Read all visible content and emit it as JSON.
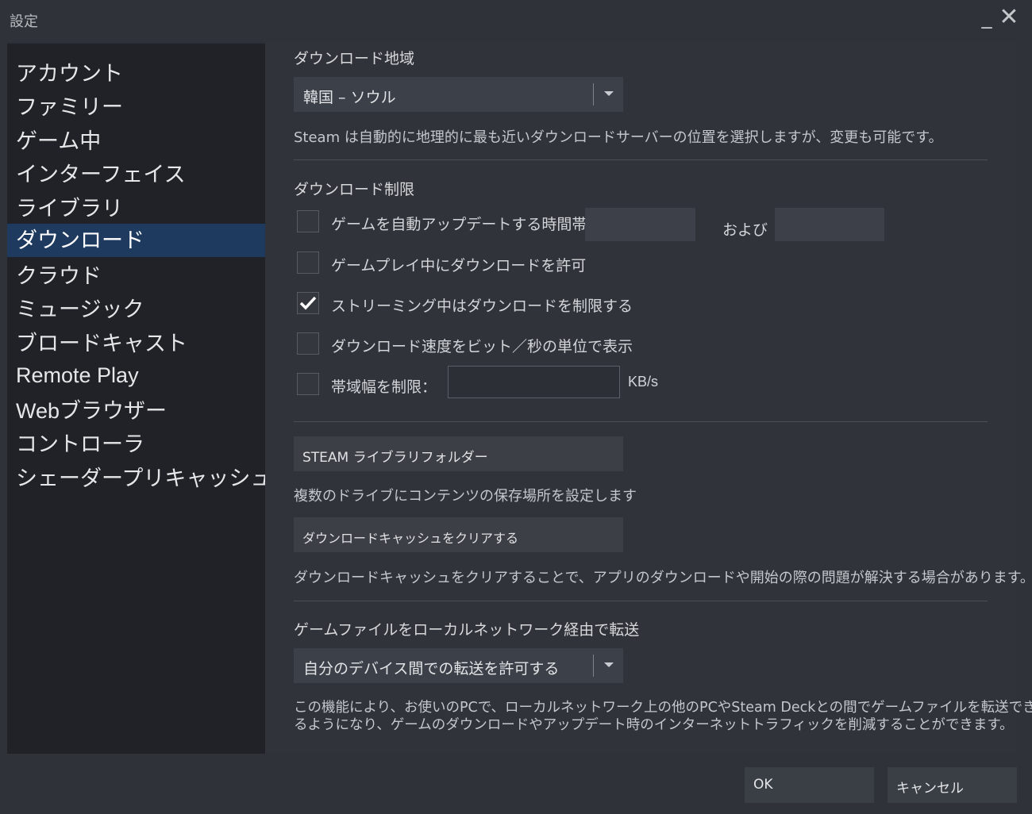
{
  "window": {
    "title": "設定",
    "minimize_label": "_",
    "close_label": "✕"
  },
  "sidebar": {
    "items": [
      {
        "label": "アカウント"
      },
      {
        "label": "ファミリー"
      },
      {
        "label": "ゲーム中"
      },
      {
        "label": "インターフェイス"
      },
      {
        "label": "ライブラリ"
      },
      {
        "label": "ダウンロード",
        "active": true
      },
      {
        "label": "クラウド"
      },
      {
        "label": "ミュージック"
      },
      {
        "label": "ブロードキャスト"
      },
      {
        "label": "Remote Play"
      },
      {
        "label": "Webブラウザー"
      },
      {
        "label": "コントローラ"
      },
      {
        "label": "シェーダープリキャッシュ"
      }
    ]
  },
  "download_region": {
    "title": "ダウンロード地域",
    "selected": "韓国 – ソウル",
    "description": "Steam は自動的に地理的に最も近いダウンロードサーバーの位置を選択しますが、変更も可能です。"
  },
  "download_limits": {
    "title": "ダウンロード制限",
    "auto_update": {
      "label": "ゲームを自動アップデートする時間帯：",
      "checked": false,
      "start_value": "",
      "end_value": "",
      "and_label": "および"
    },
    "allow_during_gameplay": {
      "label": "ゲームプレイ中にダウンロードを許可",
      "checked": false
    },
    "throttle_streaming": {
      "label": "ストリーミング中はダウンロードを制限する",
      "checked": true
    },
    "show_bits": {
      "label": "ダウンロード速度をビット／秒の単位で表示",
      "checked": false
    },
    "limit_bandwidth": {
      "label": "帯域幅を制限：",
      "checked": false,
      "value": "",
      "unit": "KB/s"
    }
  },
  "library": {
    "folders_button": "STEAM ライブラリフォルダー",
    "folders_desc": "複数のドライブにコンテンツの保存場所を設定します",
    "clear_cache_button": "ダウンロードキャッシュをクリアする",
    "clear_cache_desc": "ダウンロードキャッシュをクリアすることで、アプリのダウンロードや開始の際の問題が解決する場合があります。"
  },
  "local_transfer": {
    "title": "ゲームファイルをローカルネットワーク経由で転送",
    "selected": "自分のデバイス間での転送を許可する",
    "desc_line1": "この機能により、お使いのPCで、ローカルネットワーク上の他のPCやSteam Deckとの間でゲームファイルを転送でき",
    "desc_line2": "るようになり、ゲームのダウンロードやアップデート時のインターネットトラフィックを削減することができます。"
  },
  "footer": {
    "ok_label": "OK",
    "cancel_label": "キャンセル"
  },
  "colors": {
    "background": "#2f3238",
    "sidebar": "#202227",
    "active_item": "#1f3a5f",
    "control": "#3c4049"
  }
}
